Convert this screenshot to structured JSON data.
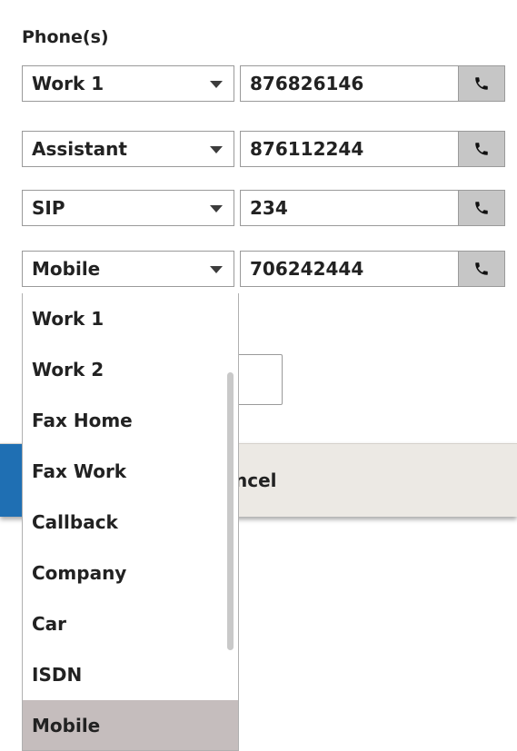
{
  "phones_section": {
    "label": "Phone(s)",
    "rows": [
      {
        "type": "Work 1",
        "number": "876826146",
        "call_icon": "phone-icon"
      },
      {
        "type": "Assistant",
        "number": "876112244",
        "call_icon": "phone-icon"
      },
      {
        "type": "SIP",
        "number": "234",
        "call_icon": "phone-icon"
      },
      {
        "type": "Mobile",
        "number": "706242444",
        "call_icon": "phone-icon"
      }
    ]
  },
  "dropdown": {
    "options": [
      "Work 1",
      "Work 2",
      "Fax Home",
      "Fax Work",
      "Callback",
      "Company",
      "Car",
      "ISDN",
      "Mobile"
    ],
    "selected": "Mobile"
  },
  "footer": {
    "cancel_label": "ncel"
  },
  "colors": {
    "call_button_bg": "#c6c6c6",
    "selected_option_bg": "#c5bdbd",
    "footer_bg": "#ece9e4",
    "ok_button": "#1f6fb3"
  }
}
